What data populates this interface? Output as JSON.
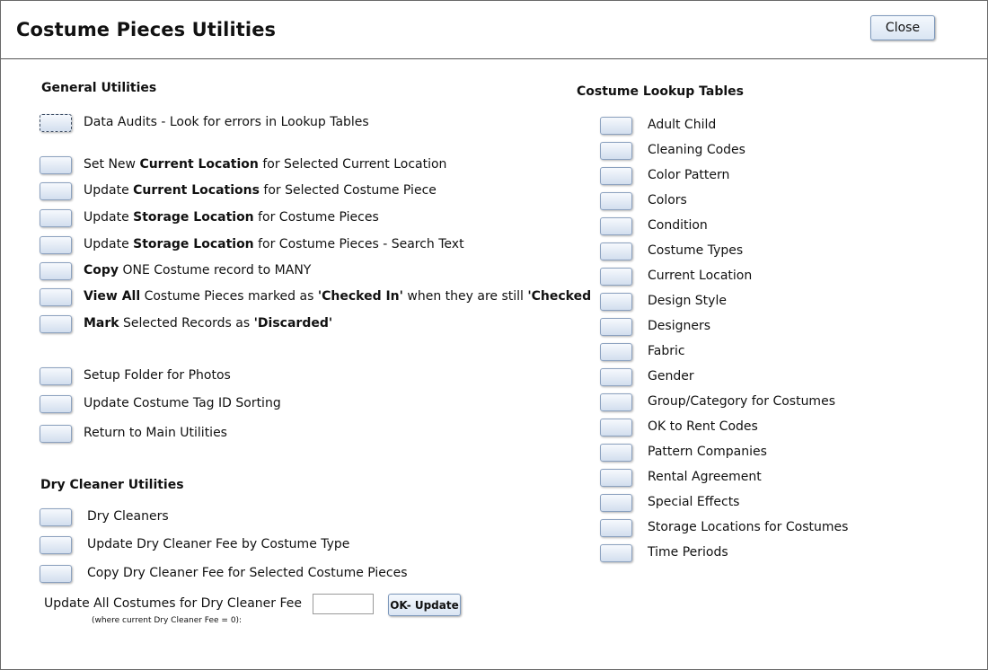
{
  "window": {
    "title": "Costume Pieces Utilities",
    "close_label": "Close"
  },
  "general": {
    "title": "General Utilities",
    "items": [
      {
        "parts": [
          {
            "t": "Data Audits - Look for errors in Lookup Tables",
            "b": false
          }
        ]
      },
      {
        "parts": [
          {
            "t": "Set New  ",
            "b": false
          },
          {
            "t": "Current Location",
            "b": true
          },
          {
            "t": " for Selected Current Location",
            "b": false
          }
        ]
      },
      {
        "parts": [
          {
            "t": "Update ",
            "b": false
          },
          {
            "t": "Current Locations",
            "b": true
          },
          {
            "t": " for Selected Costume Piece",
            "b": false
          }
        ]
      },
      {
        "parts": [
          {
            "t": "Update ",
            "b": false
          },
          {
            "t": "Storage Location",
            "b": true
          },
          {
            "t": " for Costume Pieces",
            "b": false
          }
        ]
      },
      {
        "parts": [
          {
            "t": "Update ",
            "b": false
          },
          {
            "t": "Storage Location",
            "b": true
          },
          {
            "t": " for Costume Pieces - Search Text",
            "b": false
          }
        ]
      },
      {
        "parts": [
          {
            "t": "Copy",
            "b": true
          },
          {
            "t": " ONE Costume record to MANY",
            "b": false
          }
        ]
      },
      {
        "parts": [
          {
            "t": "View All",
            "b": true
          },
          {
            "t": " Costume Pieces marked as ",
            "b": false
          },
          {
            "t": "'Checked In'",
            "b": true
          },
          {
            "t": " when they are still ",
            "b": false
          },
          {
            "t": "'Checked",
            "b": true
          }
        ]
      },
      {
        "parts": [
          {
            "t": "Mark",
            "b": true
          },
          {
            "t": " Selected Records as ",
            "b": false
          },
          {
            "t": "'Discarded'",
            "b": true
          }
        ]
      },
      {
        "parts": [
          {
            "t": "Setup Folder for Photos",
            "b": false
          }
        ]
      },
      {
        "parts": [
          {
            "t": "Update Costume Tag ID Sorting",
            "b": false
          }
        ]
      },
      {
        "parts": [
          {
            "t": "Return to Main Utilities",
            "b": false
          }
        ]
      }
    ]
  },
  "dry_cleaner": {
    "title": "Dry Cleaner Utilities",
    "items": [
      {
        "label": "Dry Cleaners"
      },
      {
        "label": "Update Dry Cleaner Fee by Costume Type"
      },
      {
        "label": "Copy Dry Cleaner Fee for Selected Costume Pieces"
      }
    ],
    "update_all_label": "Update All Costumes for Dry Cleaner Fee",
    "update_all_note": "(where current Dry Cleaner Fee = 0):",
    "fee_value": "",
    "ok_label": "OK- Update"
  },
  "lookup": {
    "title": "Costume  Lookup Tables",
    "items": [
      "Adult Child",
      "Cleaning Codes",
      "Color Pattern",
      "Colors",
      "Condition",
      "Costume Types",
      "Current Location",
      "Design Style",
      "Designers",
      "Fabric",
      "Gender",
      "Group/Category for Costumes",
      "OK to Rent Codes",
      "Pattern Companies",
      "Rental Agreement",
      "Special Effects",
      "Storage Locations for Costumes",
      "Time Periods"
    ]
  }
}
